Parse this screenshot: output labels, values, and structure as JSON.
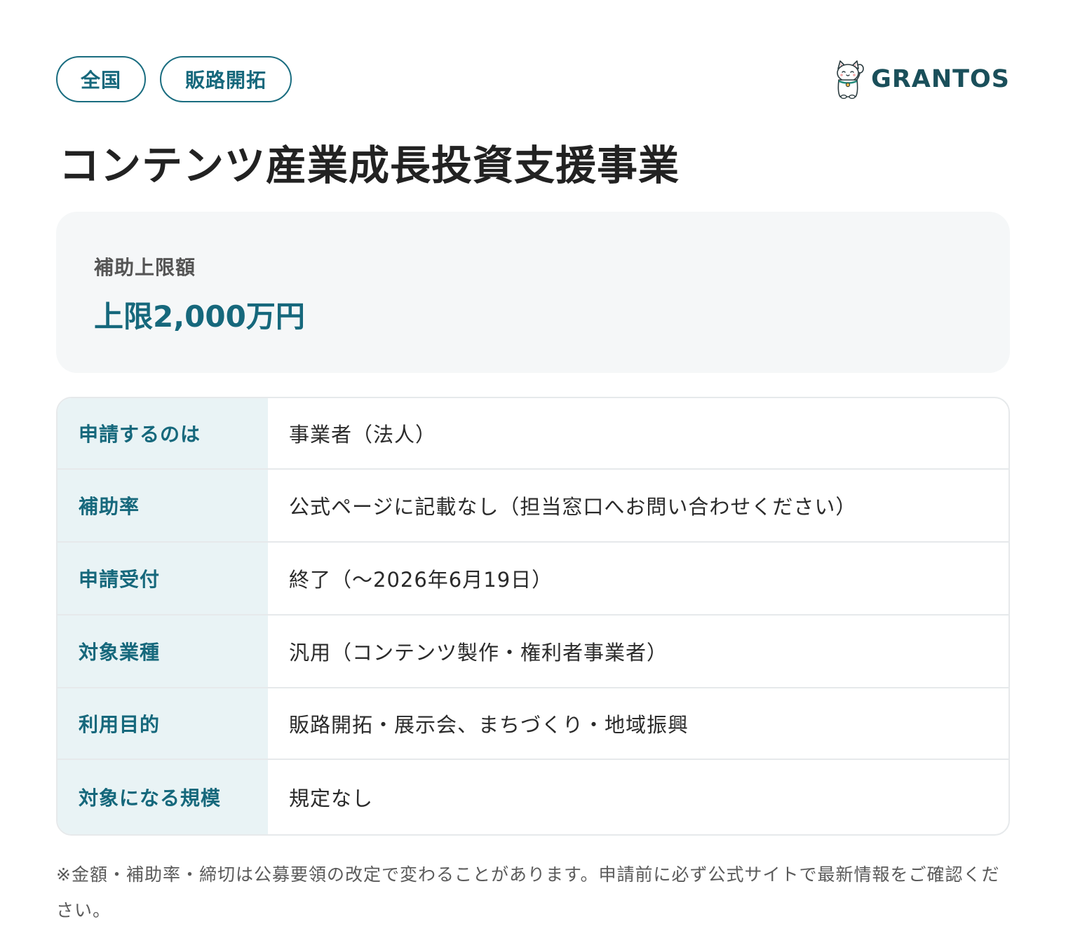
{
  "tags": [
    "全国",
    "販路開拓"
  ],
  "brand": {
    "logo_icon": "maneki-neko-cat-icon",
    "name": "GRANTOS",
    "color": "#1a4f5a"
  },
  "title": "コンテンツ産業成長投資支援事業",
  "amount": {
    "label": "補助上限額",
    "value": "上限2,000万円"
  },
  "info_rows": [
    {
      "label": "申請するのは",
      "value": "事業者（法人）"
    },
    {
      "label": "補助率",
      "value": "公式ページに記載なし（担当窓口へお問い合わせください）"
    },
    {
      "label": "申請受付",
      "value": "終了（〜2026年6月19日）"
    },
    {
      "label": "対象業種",
      "value": "汎用（コンテンツ製作・権利者事業者）"
    },
    {
      "label": "利用目的",
      "value": "販路開拓・展示会、まちづくり・地域振興"
    },
    {
      "label": "対象になる規模",
      "value": "規定なし"
    }
  ],
  "footnote": "※金額・補助率・締切は公募要領の改定で変わることがあります。申請前に必ず公式サイトで最新情報をご確認ください。",
  "colors": {
    "accent": "#16687c",
    "label_bg": "#e9f3f5",
    "card_bg": "#f5f7f8",
    "border": "#e6e9eb"
  }
}
